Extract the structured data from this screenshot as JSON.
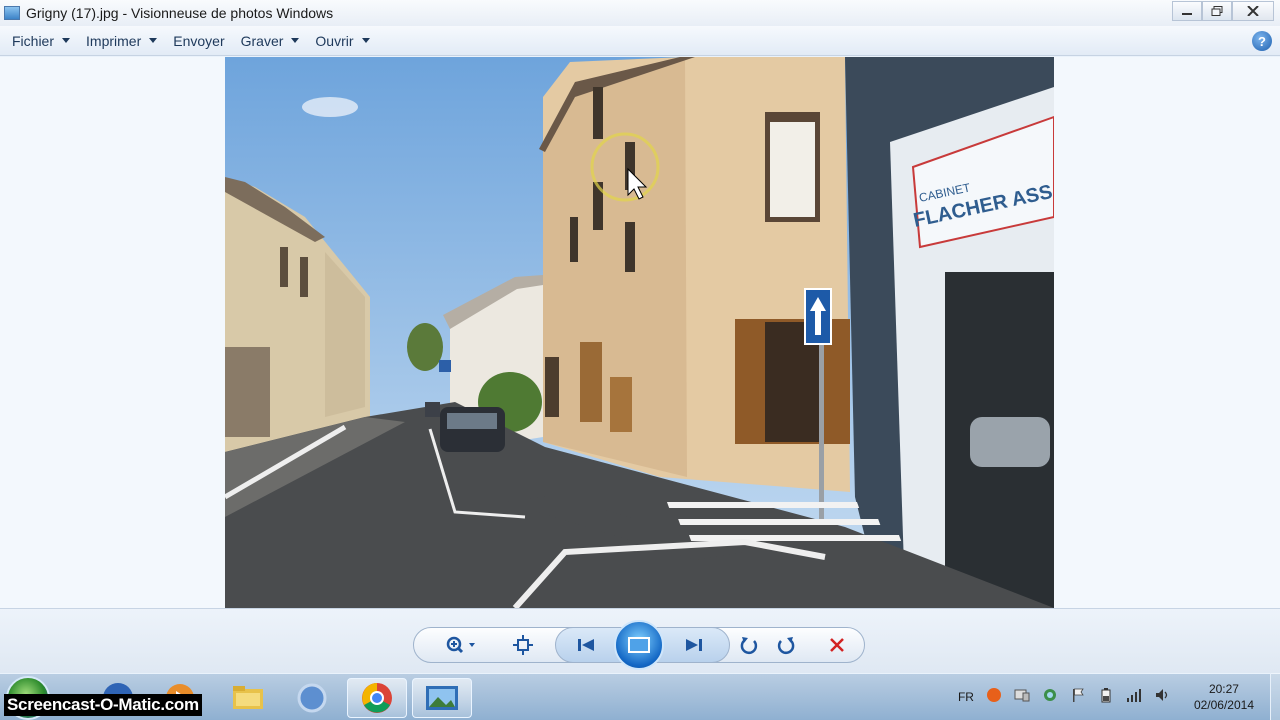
{
  "window": {
    "title": "Grigny (17).jpg - Visionneuse de photos Windows"
  },
  "menu": [
    {
      "label": "Fichier",
      "has_dropdown": true
    },
    {
      "label": "Imprimer",
      "has_dropdown": true
    },
    {
      "label": "Envoyer",
      "has_dropdown": false
    },
    {
      "label": "Graver",
      "has_dropdown": true
    },
    {
      "label": "Ouvrir",
      "has_dropdown": true
    }
  ],
  "help_label": "?",
  "photo": {
    "sign_text_line1": "CABINET",
    "sign_text_line2": "FLACHER ASS"
  },
  "controls": {
    "zoom": "zoom-icon",
    "fit": "actual-size-icon",
    "previous": "previous-icon",
    "slideshow": "slideshow-icon",
    "next": "next-icon",
    "rotate_left": "rotate-counterclockwise-icon",
    "rotate_right": "rotate-clockwise-icon",
    "delete": "delete-icon"
  },
  "taskbar": {
    "watermark": "Screencast-O-Matic.com",
    "language": "FR",
    "time": "20:27",
    "date": "02/06/2014"
  },
  "colors": {
    "accent": "#1e56a0",
    "delete": "#d22222",
    "sky": "#8fbbe8",
    "facade": "#e4caa3"
  }
}
